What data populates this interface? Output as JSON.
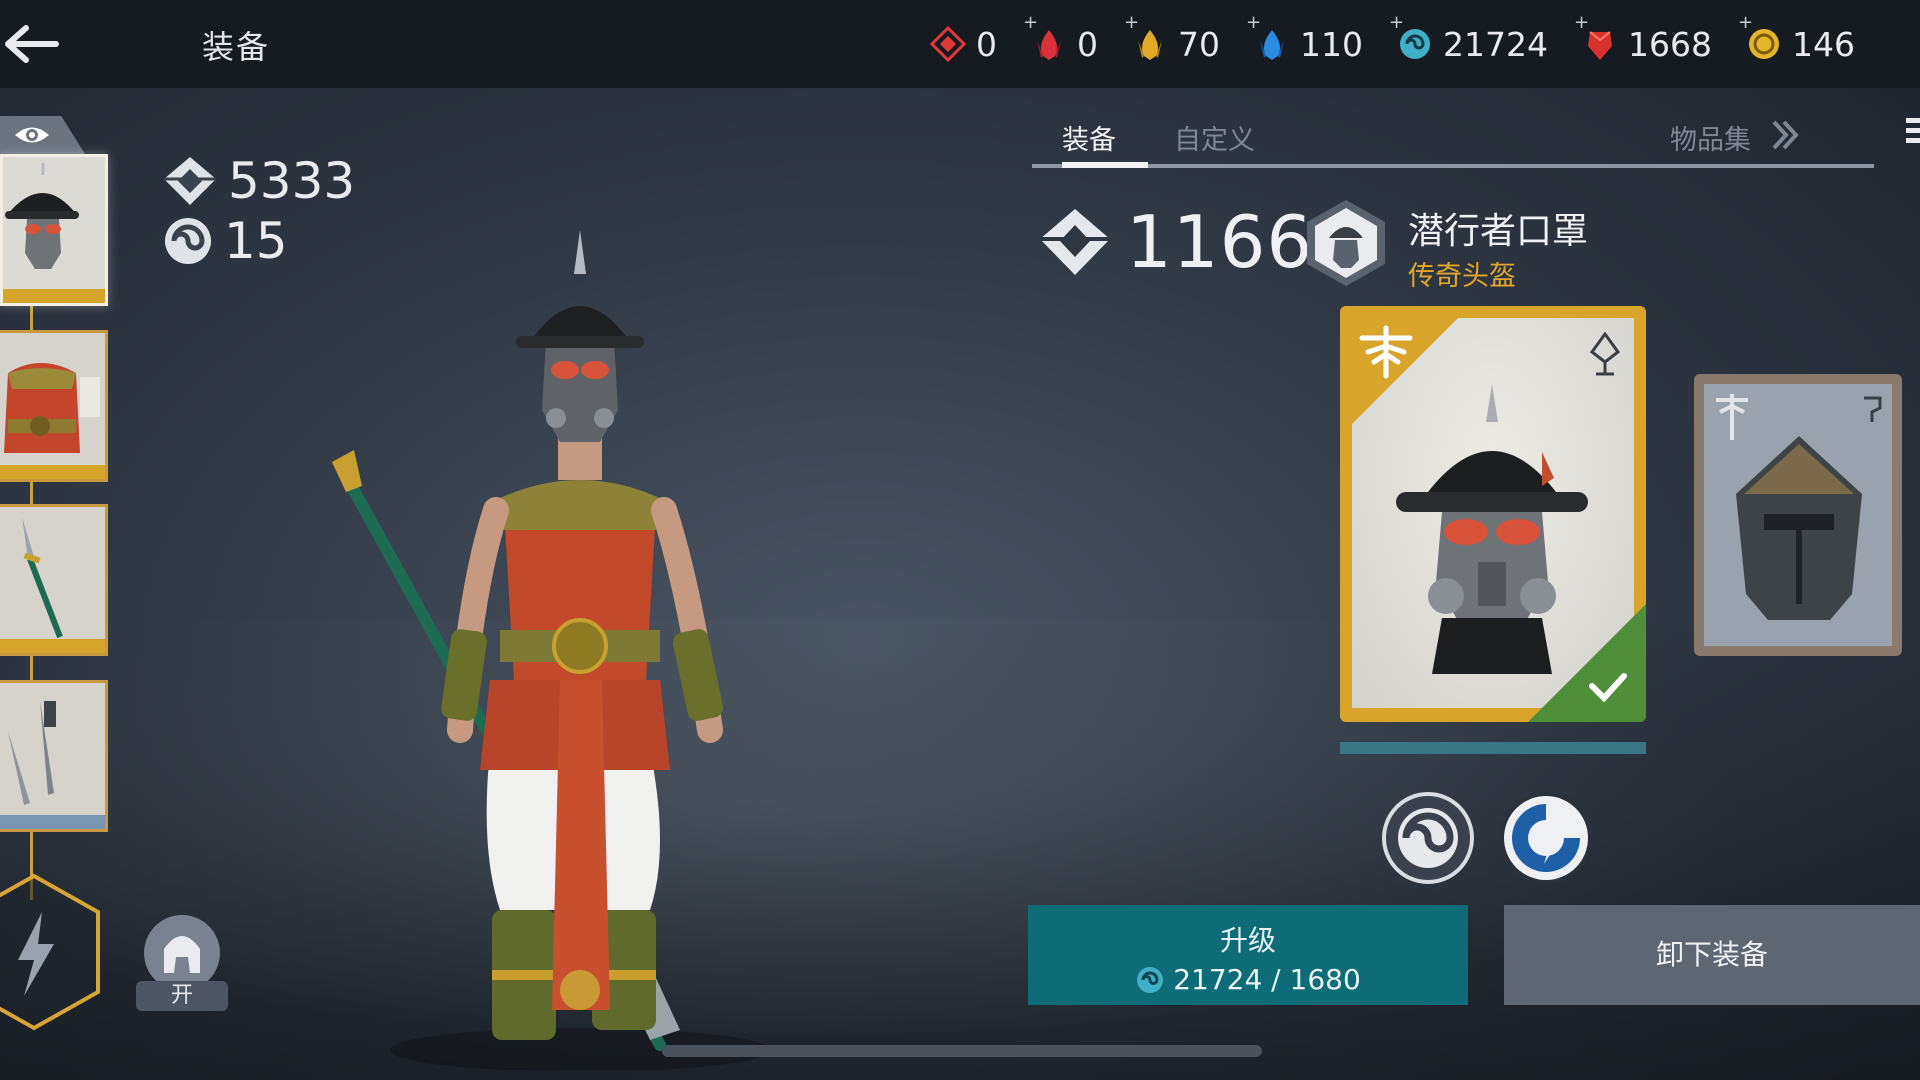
{
  "header": {
    "title": "装备"
  },
  "currencies": [
    {
      "icon": "red-diamond-icon",
      "value": "0",
      "plus": false,
      "color": "#e23a3a"
    },
    {
      "icon": "red-gem-icon",
      "value": "0",
      "plus": true,
      "color": "#d9323a"
    },
    {
      "icon": "gold-gem-icon",
      "value": "70",
      "plus": true,
      "color": "#e0a928"
    },
    {
      "icon": "blue-gem-icon",
      "value": "110",
      "plus": true,
      "color": "#2a8be0"
    },
    {
      "icon": "swirl-currency-icon",
      "value": "21724",
      "plus": true,
      "color": "#3fb0c7"
    },
    {
      "icon": "ruby-icon",
      "value": "1668",
      "plus": true,
      "color": "#d9322d"
    },
    {
      "icon": "gold-coin-icon",
      "value": "146",
      "plus": true,
      "color": "#e2b52a"
    }
  ],
  "plus_sign": "+",
  "stats": {
    "power": "5333",
    "level": "15"
  },
  "helmet_toggle": {
    "label": "开"
  },
  "tabs": {
    "equip": "装备",
    "customize": "自定义",
    "collection": "物品集"
  },
  "item": {
    "power": "1166",
    "name": "潜行者口罩",
    "type": "传奇头盔",
    "type_color": "#e2a72a"
  },
  "buttons": {
    "upgrade_label": "升级",
    "upgrade_cost": "21724 / 1680",
    "unequip_label": "卸下装备"
  }
}
